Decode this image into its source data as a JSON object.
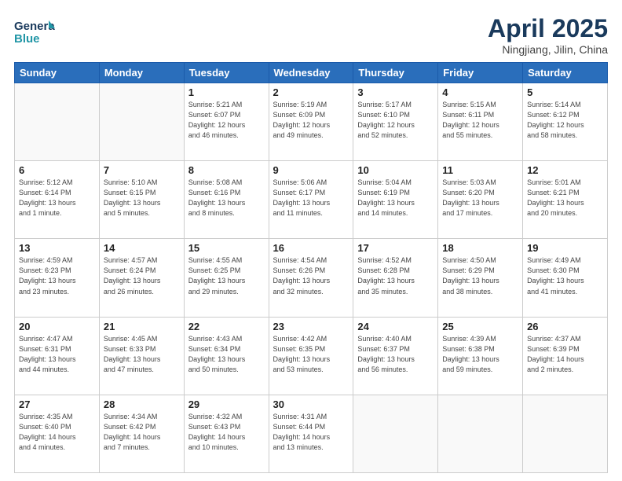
{
  "header": {
    "logo_line1": "General",
    "logo_line2": "Blue",
    "title": "April 2025",
    "subtitle": "Ningjiang, Jilin, China"
  },
  "weekdays": [
    "Sunday",
    "Monday",
    "Tuesday",
    "Wednesday",
    "Thursday",
    "Friday",
    "Saturday"
  ],
  "weeks": [
    [
      {
        "day": "",
        "info": ""
      },
      {
        "day": "",
        "info": ""
      },
      {
        "day": "1",
        "info": "Sunrise: 5:21 AM\nSunset: 6:07 PM\nDaylight: 12 hours\nand 46 minutes."
      },
      {
        "day": "2",
        "info": "Sunrise: 5:19 AM\nSunset: 6:09 PM\nDaylight: 12 hours\nand 49 minutes."
      },
      {
        "day": "3",
        "info": "Sunrise: 5:17 AM\nSunset: 6:10 PM\nDaylight: 12 hours\nand 52 minutes."
      },
      {
        "day": "4",
        "info": "Sunrise: 5:15 AM\nSunset: 6:11 PM\nDaylight: 12 hours\nand 55 minutes."
      },
      {
        "day": "5",
        "info": "Sunrise: 5:14 AM\nSunset: 6:12 PM\nDaylight: 12 hours\nand 58 minutes."
      }
    ],
    [
      {
        "day": "6",
        "info": "Sunrise: 5:12 AM\nSunset: 6:14 PM\nDaylight: 13 hours\nand 1 minute."
      },
      {
        "day": "7",
        "info": "Sunrise: 5:10 AM\nSunset: 6:15 PM\nDaylight: 13 hours\nand 5 minutes."
      },
      {
        "day": "8",
        "info": "Sunrise: 5:08 AM\nSunset: 6:16 PM\nDaylight: 13 hours\nand 8 minutes."
      },
      {
        "day": "9",
        "info": "Sunrise: 5:06 AM\nSunset: 6:17 PM\nDaylight: 13 hours\nand 11 minutes."
      },
      {
        "day": "10",
        "info": "Sunrise: 5:04 AM\nSunset: 6:19 PM\nDaylight: 13 hours\nand 14 minutes."
      },
      {
        "day": "11",
        "info": "Sunrise: 5:03 AM\nSunset: 6:20 PM\nDaylight: 13 hours\nand 17 minutes."
      },
      {
        "day": "12",
        "info": "Sunrise: 5:01 AM\nSunset: 6:21 PM\nDaylight: 13 hours\nand 20 minutes."
      }
    ],
    [
      {
        "day": "13",
        "info": "Sunrise: 4:59 AM\nSunset: 6:23 PM\nDaylight: 13 hours\nand 23 minutes."
      },
      {
        "day": "14",
        "info": "Sunrise: 4:57 AM\nSunset: 6:24 PM\nDaylight: 13 hours\nand 26 minutes."
      },
      {
        "day": "15",
        "info": "Sunrise: 4:55 AM\nSunset: 6:25 PM\nDaylight: 13 hours\nand 29 minutes."
      },
      {
        "day": "16",
        "info": "Sunrise: 4:54 AM\nSunset: 6:26 PM\nDaylight: 13 hours\nand 32 minutes."
      },
      {
        "day": "17",
        "info": "Sunrise: 4:52 AM\nSunset: 6:28 PM\nDaylight: 13 hours\nand 35 minutes."
      },
      {
        "day": "18",
        "info": "Sunrise: 4:50 AM\nSunset: 6:29 PM\nDaylight: 13 hours\nand 38 minutes."
      },
      {
        "day": "19",
        "info": "Sunrise: 4:49 AM\nSunset: 6:30 PM\nDaylight: 13 hours\nand 41 minutes."
      }
    ],
    [
      {
        "day": "20",
        "info": "Sunrise: 4:47 AM\nSunset: 6:31 PM\nDaylight: 13 hours\nand 44 minutes."
      },
      {
        "day": "21",
        "info": "Sunrise: 4:45 AM\nSunset: 6:33 PM\nDaylight: 13 hours\nand 47 minutes."
      },
      {
        "day": "22",
        "info": "Sunrise: 4:43 AM\nSunset: 6:34 PM\nDaylight: 13 hours\nand 50 minutes."
      },
      {
        "day": "23",
        "info": "Sunrise: 4:42 AM\nSunset: 6:35 PM\nDaylight: 13 hours\nand 53 minutes."
      },
      {
        "day": "24",
        "info": "Sunrise: 4:40 AM\nSunset: 6:37 PM\nDaylight: 13 hours\nand 56 minutes."
      },
      {
        "day": "25",
        "info": "Sunrise: 4:39 AM\nSunset: 6:38 PM\nDaylight: 13 hours\nand 59 minutes."
      },
      {
        "day": "26",
        "info": "Sunrise: 4:37 AM\nSunset: 6:39 PM\nDaylight: 14 hours\nand 2 minutes."
      }
    ],
    [
      {
        "day": "27",
        "info": "Sunrise: 4:35 AM\nSunset: 6:40 PM\nDaylight: 14 hours\nand 4 minutes."
      },
      {
        "day": "28",
        "info": "Sunrise: 4:34 AM\nSunset: 6:42 PM\nDaylight: 14 hours\nand 7 minutes."
      },
      {
        "day": "29",
        "info": "Sunrise: 4:32 AM\nSunset: 6:43 PM\nDaylight: 14 hours\nand 10 minutes."
      },
      {
        "day": "30",
        "info": "Sunrise: 4:31 AM\nSunset: 6:44 PM\nDaylight: 14 hours\nand 13 minutes."
      },
      {
        "day": "",
        "info": ""
      },
      {
        "day": "",
        "info": ""
      },
      {
        "day": "",
        "info": ""
      }
    ]
  ]
}
